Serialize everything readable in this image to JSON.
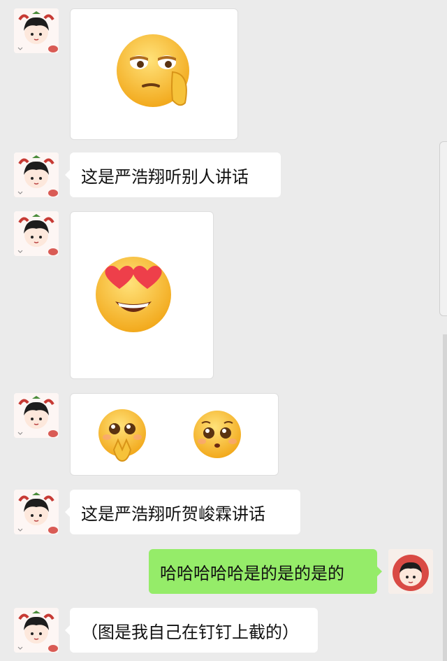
{
  "messages": [
    {
      "type": "image",
      "side": "left",
      "emoji": "smirk-hand-face-emoji"
    },
    {
      "type": "text",
      "side": "left",
      "text": "这是严浩翔听别人讲话"
    },
    {
      "type": "image",
      "side": "left",
      "emoji": "heart-eyes-emoji"
    },
    {
      "type": "image",
      "side": "left",
      "emoji": [
        "pleading-hands-emoji",
        "pleading-face-emoji"
      ]
    },
    {
      "type": "text",
      "side": "left",
      "text": "这是严浩翔听贺峻霖讲话"
    },
    {
      "type": "text",
      "side": "right",
      "text": "哈哈哈哈哈是的是的是的"
    },
    {
      "type": "text",
      "side": "left",
      "text": "（图是我自己在钉钉上截的）"
    }
  ],
  "colors": {
    "background": "#ebebeb",
    "bubble_left": "#ffffff",
    "bubble_right": "#95ec69"
  }
}
